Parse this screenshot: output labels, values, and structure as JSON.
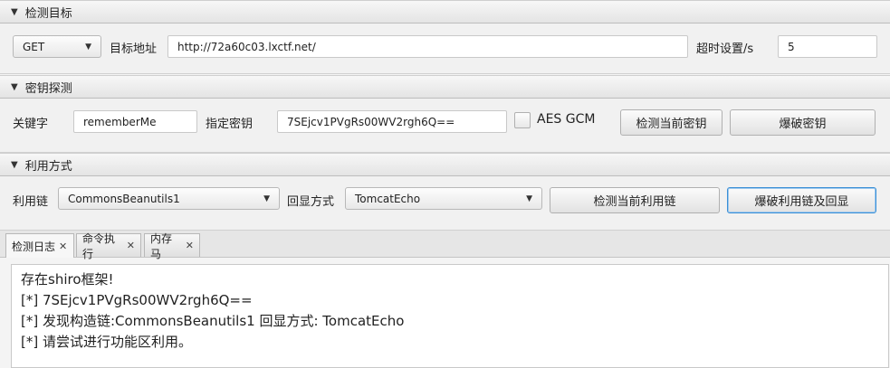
{
  "target_section": {
    "title": "检测目标",
    "method": "GET",
    "url_label": "目标地址",
    "url_value": "http://72a60c03.lxctf.net/",
    "timeout_label": "超时设置/s",
    "timeout_value": "5"
  },
  "key_section": {
    "title": "密钥探测",
    "keyword_label": "关键字",
    "keyword_value": "rememberMe",
    "key_label": "指定密钥",
    "key_value": "7SEjcv1PVgRs00WV2rgh6Q==",
    "aes_gcm_label": "AES GCM",
    "aes_gcm_checked": false,
    "detect_key_button": "检测当前密钥",
    "brute_key_button": "爆破密钥"
  },
  "exploit_section": {
    "title": "利用方式",
    "chain_label": "利用链",
    "chain_value": "CommonsBeanutils1",
    "echo_label": "回显方式",
    "echo_value": "TomcatEcho",
    "detect_chain_button": "检测当前利用链",
    "brute_chain_button": "爆破利用链及回显"
  },
  "tabs": [
    {
      "label": "检测日志",
      "active": true
    },
    {
      "label": "命令执行",
      "active": false
    },
    {
      "label": "内存马",
      "active": false
    }
  ],
  "log_lines": [
    "存在shiro框架!",
    "[*] 7SEjcv1PVgRs00WV2rgh6Q==",
    "[*] 发现构造链:CommonsBeanutils1  回显方式: TomcatEcho",
    "[*] 请尝试进行功能区利用。"
  ],
  "icons": {
    "collapse": "triangle-down-icon",
    "dropdown": "chevron-down-icon",
    "close": "close-icon"
  }
}
